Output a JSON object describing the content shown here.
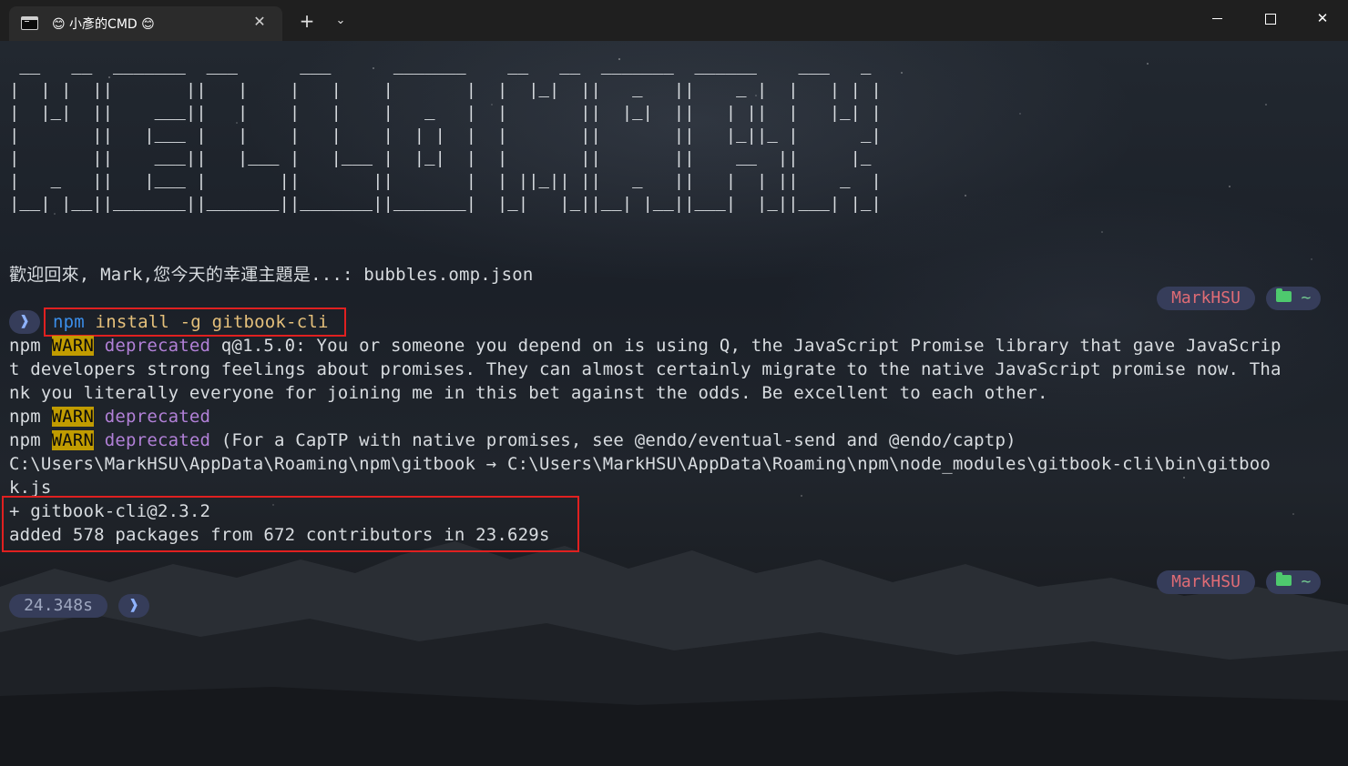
{
  "window": {
    "tab_title": "😊 小彥的CMD 😊",
    "tab_close": "✕",
    "new_tab": "+",
    "dropdown": "⌄",
    "minimize_icon": "minimize-icon",
    "maximize_icon": "maximize-icon",
    "close": "✕"
  },
  "banner": {
    "ascii_art": " __   __  _______  ___      ___      _______    __   __  _______  ______    ___   _ \n|  | |  ||       ||   |    |   |    |       |  |  |_|  ||   _   ||    _ |  |   | | |\n|  |_|  ||    ___||   |    |   |    |   _   |  |       ||  |_|  ||   | ||  |   |_| |\n|       ||   |___ |   |    |   |    |  | |  |  |       ||       ||   |_||_ |      _|\n|       ||    ___||   |___ |   |___ |  |_|  |  |       ||       ||    __  ||     |_ \n|   _   ||   |___ |       ||       ||       |  | ||_|| ||   _   ||   |  | ||    _  |\n|__| |__||_______||_______||_______||_______|  |_|   |_||__| |__||___|  |_||___| |_|",
    "welcome": "歡迎回來, Mark,您今天的幸運主題是...: bubbles.omp.json"
  },
  "prompt1": {
    "user": "MarkHSU",
    "dir": "~",
    "arrow": "❱",
    "command_bin": "npm",
    "command_args": " install -g gitbook-cli"
  },
  "output": {
    "npm": "npm",
    "warn": "WARN",
    "deprecated": "deprecated",
    "warn1_msg": " q@1.5.0: You or someone you depend on is using Q, the JavaScript Promise library that gave JavaScrip",
    "warn1_l2": "t developers strong feelings about promises. They can almost certainly migrate to the native JavaScript promise now. Tha",
    "warn1_l3": "nk you literally everyone for joining me in this bet against the odds. Be excellent to each other.",
    "warn3_msg": " (For a CapTP with native promises, see @endo/eventual-send and @endo/captp)",
    "link_l1": "C:\\Users\\MarkHSU\\AppData\\Roaming\\npm\\gitbook → C:\\Users\\MarkHSU\\AppData\\Roaming\\npm\\node_modules\\gitbook-cli\\bin\\gitboo",
    "link_l2": "k.js",
    "installed": "+ gitbook-cli@2.3.2",
    "summary": "added 578 packages from 672 contributors in 23.629s"
  },
  "prompt2": {
    "user": "MarkHSU",
    "dir": "~",
    "duration": "24.348s",
    "arrow": "❱"
  }
}
